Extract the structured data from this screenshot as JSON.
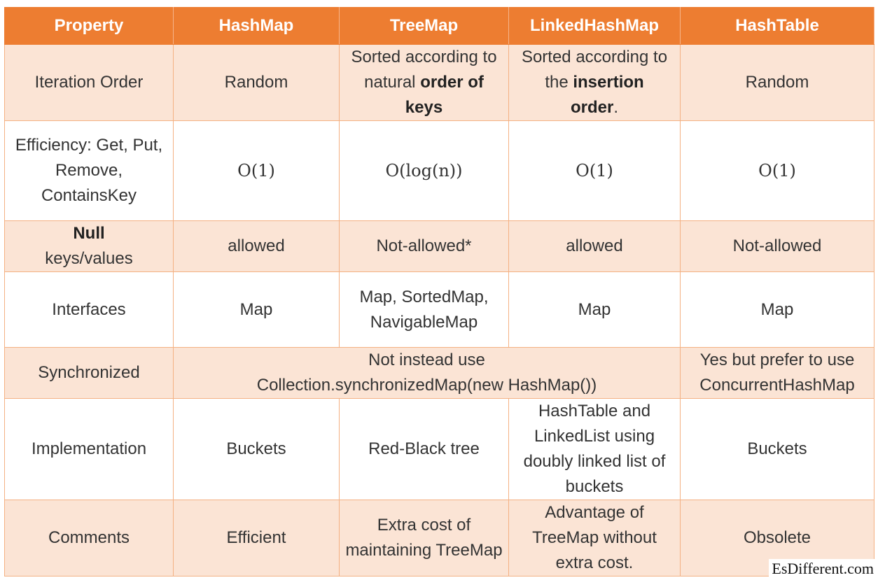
{
  "header": [
    "Property",
    "HashMap",
    "TreeMap",
    "LinkedHashMap",
    "HashTable"
  ],
  "rows": {
    "iteration": {
      "label": "Iteration Order",
      "hashmap": "Random",
      "treemap": {
        "pre": "Sorted according to natural ",
        "bold": "order of keys",
        "post": ""
      },
      "linked": {
        "pre": "Sorted according to the ",
        "bold1": "insertion",
        "mid": " ",
        "bold2": "order",
        "post": "."
      },
      "hashtable": "Random"
    },
    "efficiency": {
      "label": "Efficiency: Get, Put, Remove, ContainsKey",
      "hashmap": "O(1)",
      "treemap": "O(log(n))",
      "linked": "O(1)",
      "hashtable": "O(1)"
    },
    "null": {
      "label_bold": "Null",
      "label_rest": "keys/values",
      "hashmap": "allowed",
      "treemap": "Not-allowed*",
      "linked": "allowed",
      "hashtable": "Not-allowed"
    },
    "interfaces": {
      "label": "Interfaces",
      "hashmap": "Map",
      "treemap": "Map, SortedMap, NavigableMap",
      "linked": "Map",
      "hashtable": "Map"
    },
    "synchronized": {
      "label": "Synchronized",
      "merged_line1": "Not instead use",
      "merged_line2": "Collection.synchronizedMap(new HashMap())",
      "hashtable": "Yes but prefer to use ConcurrentHashMap"
    },
    "implementation": {
      "label": "Implementation",
      "hashmap": "Buckets",
      "treemap": "Red-Black tree",
      "linked": "HashTable and LinkedList using doubly linked list of buckets",
      "hashtable": "Buckets"
    },
    "comments": {
      "label": "Comments",
      "hashmap": "Efficient",
      "treemap": "Extra cost of maintaining TreeMap",
      "linked": "Advantage of TreeMap without extra cost.",
      "hashtable": "Obsolete"
    }
  },
  "watermark": "EsDifferent.com"
}
